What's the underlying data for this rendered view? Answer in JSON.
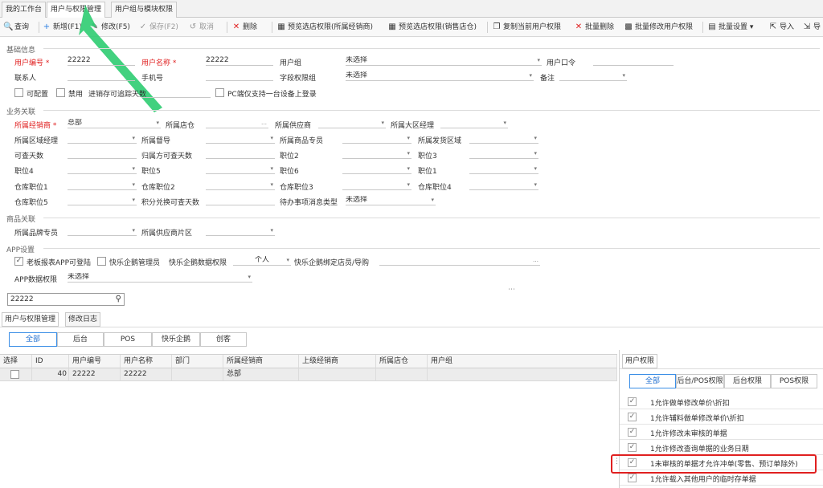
{
  "top_tabs": [
    "我的工作台",
    "用户与权限管理",
    "用户组与模块权限"
  ],
  "toolbar": {
    "query": "查询",
    "add": "新增(F1)",
    "edit": "修改(F5)",
    "save": "保存(F2)",
    "cancel": "取消",
    "delete": "删除",
    "preview_dealer": "预览选店权限(所属经销商)",
    "preview_sales": "预览选店权限(销售店仓)",
    "copy_user": "复制当前用户权限",
    "batch_delete": "批量删除",
    "batch_edit": "批量修改用户权限",
    "batch_settings": "批量设置",
    "import": "导入",
    "export": "导"
  },
  "sections": {
    "basic": "基础信息",
    "business": "业务关联",
    "goods": "商品关联",
    "app": "APP设置"
  },
  "basic": {
    "user_no_label": "用户编号",
    "user_no": "22222",
    "user_name_label": "用户名称",
    "user_name": "22222",
    "user_group_label": "用户组",
    "user_group": "未选择",
    "password_label": "用户口令",
    "contact_label": "联系人",
    "mobile_label": "手机号",
    "field_perm_label": "字段权限组",
    "field_perm": "未选择",
    "remark_label": "备注",
    "configurable": "可配置",
    "disabled": "禁用",
    "trace_days_label": "进销存可追踪天数",
    "pc_single_device": "PC端仅支持一台设备上登录"
  },
  "business": {
    "dealer_label": "所属经销商",
    "dealer": "总部",
    "store_label": "所属店仓",
    "supplier_label": "所属供应商",
    "region_mgr_label": "所属大区经理",
    "area_mgr_label": "所属区域经理",
    "supervisor_label": "所属督导",
    "goods_specialist_label": "所属商品专员",
    "ship_area_label": "所属发货区域",
    "check_days_label": "可查天数",
    "owner_check_days_label": "归属方可查天数",
    "post2_label": "职位2",
    "post3_label": "职位3",
    "post4_label": "职位4",
    "post5_label": "职位5",
    "post6_label": "职位6",
    "post1_label": "职位1",
    "wh_post1_label": "仓库职位1",
    "wh_post2_label": "仓库职位2",
    "wh_post3_label": "仓库职位3",
    "wh_post4_label": "仓库职位4",
    "wh_post5_label": "仓库职位5",
    "points_days_label": "积分兑换可查天数",
    "todo_type_label": "待办事项消息类型",
    "todo_type": "未选择"
  },
  "goods": {
    "brand_label": "所属品牌专员",
    "supplier_area_label": "所属供应商片区"
  },
  "app": {
    "boss_report": "老板报表APP可登陆",
    "kuaile_admin": "快乐企鹅管理员",
    "kuaile_perm_label": "快乐企鹅数据权限",
    "kuaile_perm": "个人",
    "kuaile_store_label": "快乐企鹅绑定店员/导购",
    "app_perm_label": "APP数据权限",
    "app_perm": "未选择"
  },
  "search": {
    "value": "22222"
  },
  "sub_tabs": [
    "用户与权限管理",
    "修改日志"
  ],
  "filter_buttons": [
    "全部",
    "后台",
    "POS",
    "快乐企鹅",
    "创客"
  ],
  "grid": {
    "columns": [
      "选择",
      "ID",
      "用户编号",
      "用户名称",
      "部门",
      "所属经销商",
      "上级经销商",
      "所属店仓",
      "用户组"
    ],
    "rows": [
      {
        "id": "40",
        "user_no": "22222",
        "user_name": "22222",
        "dept": "",
        "dealer": "总部"
      }
    ]
  },
  "perm_panel": {
    "tab": "用户权限",
    "buttons": [
      "全部",
      "后台/POS权限",
      "后台权限",
      "POS权限"
    ],
    "items": [
      "1允许做单修改单价\\折扣",
      "1允许辅料做单修改单价\\折扣",
      "1允许修改未审核的单据",
      "1允许修改查询单据的业务日期",
      "1未审核的单据才允许冲单(零售、预订单除外)",
      "1允许载入其他用户的临时存单据"
    ]
  },
  "colors": {
    "accent": "#3a8ee6",
    "required": "#e02020",
    "arrow": "#2ecc71"
  }
}
